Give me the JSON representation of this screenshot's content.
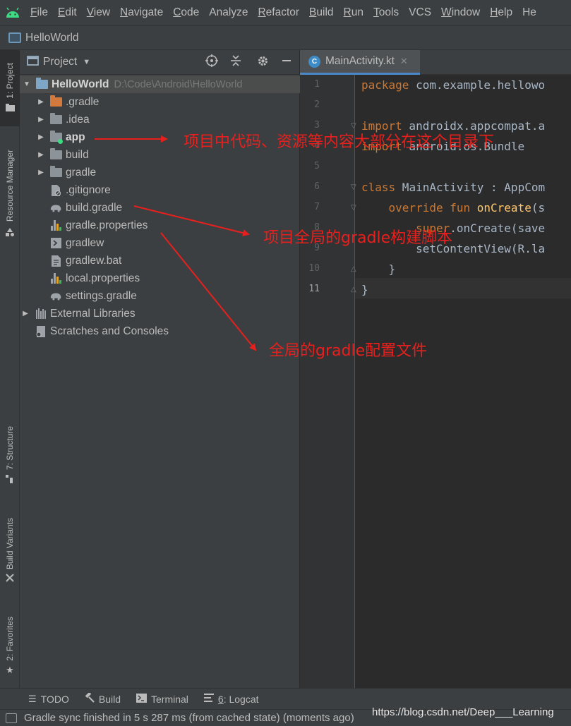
{
  "menubar": {
    "items": [
      {
        "label": "File",
        "underline": "F",
        "rest": "ile"
      },
      {
        "label": "Edit",
        "underline": "E",
        "rest": "dit"
      },
      {
        "label": "View",
        "underline": "V",
        "rest": "iew"
      },
      {
        "label": "Navigate",
        "underline": "N",
        "rest": "avigate"
      },
      {
        "label": "Code",
        "underline": "C",
        "rest": "ode"
      },
      {
        "label": "Analyze",
        "underline": "",
        "rest": "Analyze"
      },
      {
        "label": "Refactor",
        "underline": "R",
        "rest": "efactor"
      },
      {
        "label": "Build",
        "underline": "B",
        "rest": "uild"
      },
      {
        "label": "Run",
        "underline": "R",
        "rest": "un"
      },
      {
        "label": "Tools",
        "underline": "T",
        "rest": "ools"
      },
      {
        "label": "VCS",
        "underline": "",
        "rest": "VCS"
      },
      {
        "label": "Window",
        "underline": "W",
        "rest": "indow"
      },
      {
        "label": "Help",
        "underline": "H",
        "rest": "elp"
      },
      {
        "label": "He",
        "underline": "",
        "rest": "He"
      }
    ]
  },
  "navbar": {
    "title": "HelloWorld"
  },
  "left_stripe": {
    "project": "1: Project",
    "resource_manager": "Resource Manager",
    "structure": "7: Structure",
    "build_variants": "Build Variants",
    "favorites": "2: Favorites"
  },
  "project_panel": {
    "title": "Project",
    "tree": [
      {
        "label": "HelloWorld",
        "path": "D:\\Code\\Android\\HelloWorld"
      },
      {
        "label": ".gradle"
      },
      {
        "label": ".idea"
      },
      {
        "label": "app"
      },
      {
        "label": "build"
      },
      {
        "label": "gradle"
      },
      {
        "label": ".gitignore"
      },
      {
        "label": "build.gradle"
      },
      {
        "label": "gradle.properties"
      },
      {
        "label": "gradlew"
      },
      {
        "label": "gradlew.bat"
      },
      {
        "label": "local.properties"
      },
      {
        "label": "settings.gradle"
      },
      {
        "label": "External Libraries"
      },
      {
        "label": "Scratches and Consoles"
      }
    ]
  },
  "editor": {
    "tab": {
      "name": "MainActivity.kt"
    },
    "line_numbers": [
      "1",
      "2",
      "3",
      "4",
      "5",
      "6",
      "7",
      "8",
      "9",
      "10",
      "11"
    ],
    "code": {
      "l1_kw": "package",
      "l1_rest": " com.example.hellowo",
      "l3_kw": "import",
      "l3_rest": " androidx.appcompat.a",
      "l4_kw": "import",
      "l4_rest": " android.os.Bundle",
      "l6_kw": "class",
      "l6_rest": " MainActivity : AppCom",
      "l7_kw": "    override fun",
      "l7_fn": " onCreate",
      "l7_rest": "(s",
      "l8_kw": "        super",
      "l8_rest": ".onCreate(save",
      "l9_rest": "        setContentView(R.la",
      "l10_rest": "    }",
      "l11_rest": "}"
    }
  },
  "bottom_tools": {
    "todo": "TODO",
    "build": "Build",
    "terminal": "Terminal",
    "logcat_num": "6",
    "logcat": ": Logcat"
  },
  "status": {
    "message": "Gradle sync finished in 5 s 287 ms (from cached state) (moments ago)"
  },
  "watermark": "https://blog.csdn.net/Deep___Learning",
  "annotations": {
    "app": "项目中代码、资源等内容大部分在这个目录下",
    "build_gradle": "项目全局的gradle构建脚本",
    "gradle_properties": "全局的gradle配置文件"
  },
  "colors": {
    "annotation_red": "#e8201d",
    "keyword_orange": "#cc7832",
    "function_yellow": "#ffc66d",
    "code_text": "#a9b7c6",
    "panel_bg": "#3c3f41",
    "editor_bg": "#2b2b2b"
  }
}
